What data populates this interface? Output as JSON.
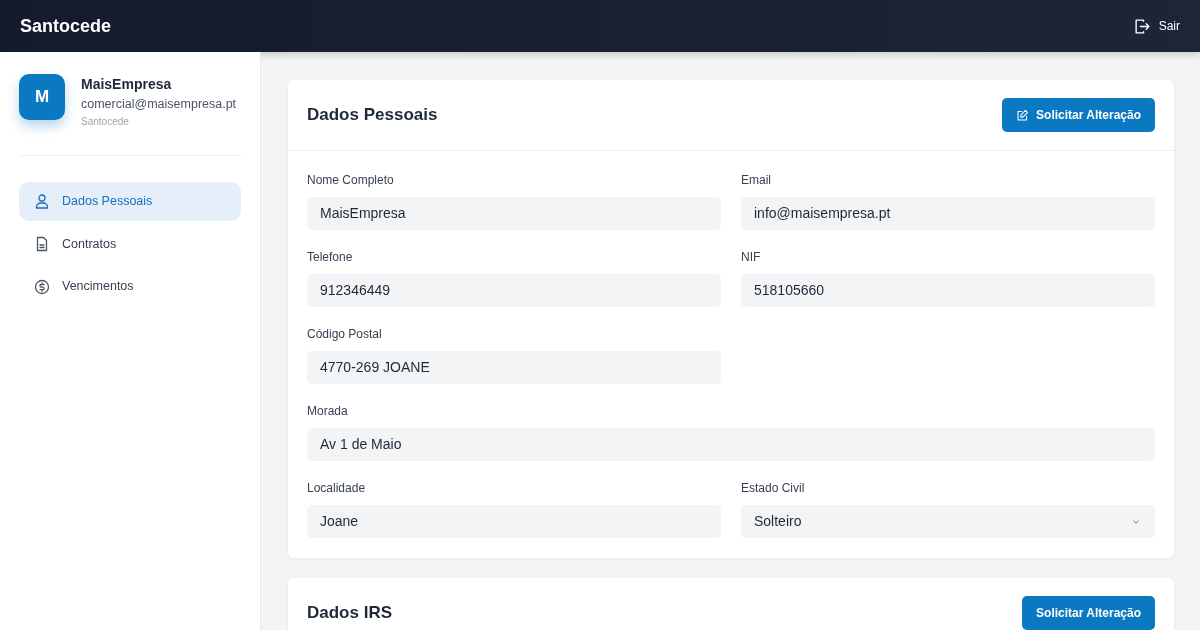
{
  "navbar": {
    "brand": "Santocede",
    "logout": "Sair"
  },
  "sidebar": {
    "profile": {
      "initial": "M",
      "name": "MaisEmpresa",
      "email": "comercial@maisempresa.pt",
      "company": "Santocede"
    },
    "items": [
      {
        "label": "Dados Pessoais",
        "selected": true
      },
      {
        "label": "Contratos",
        "selected": false
      },
      {
        "label": "Vencimentos",
        "selected": false
      }
    ]
  },
  "sections": [
    {
      "title": "Dados Pessoais",
      "button": {
        "label": "Solicitar Alteração",
        "icon": true
      },
      "fields": [
        {
          "label": "Nome Completo",
          "value": "MaisEmpresa",
          "kind": "text",
          "full_width": false
        },
        {
          "label": "Email",
          "value": "info@maisempresa.pt",
          "kind": "text",
          "full_width": false
        },
        {
          "label": "Telefone",
          "value": "912346449",
          "kind": "text",
          "full_width": false
        },
        {
          "label": "NIF",
          "value": "518105660",
          "kind": "text",
          "full_width": false
        },
        {
          "label": "Código Postal",
          "value": "4770-269 JOANE",
          "kind": "text",
          "full_width": false
        },
        {
          "label": "Morada",
          "value": "Av 1 de Maio",
          "kind": "text",
          "full_width": true
        },
        {
          "label": "Localidade",
          "value": "Joane",
          "kind": "text",
          "full_width": false
        },
        {
          "label": "Estado Civil",
          "value": "Solteiro",
          "kind": "select",
          "full_width": false
        }
      ]
    },
    {
      "title": "Dados IRS",
      "button": {
        "label": "Solicitar Alteração",
        "icon": false
      }
    }
  ]
}
